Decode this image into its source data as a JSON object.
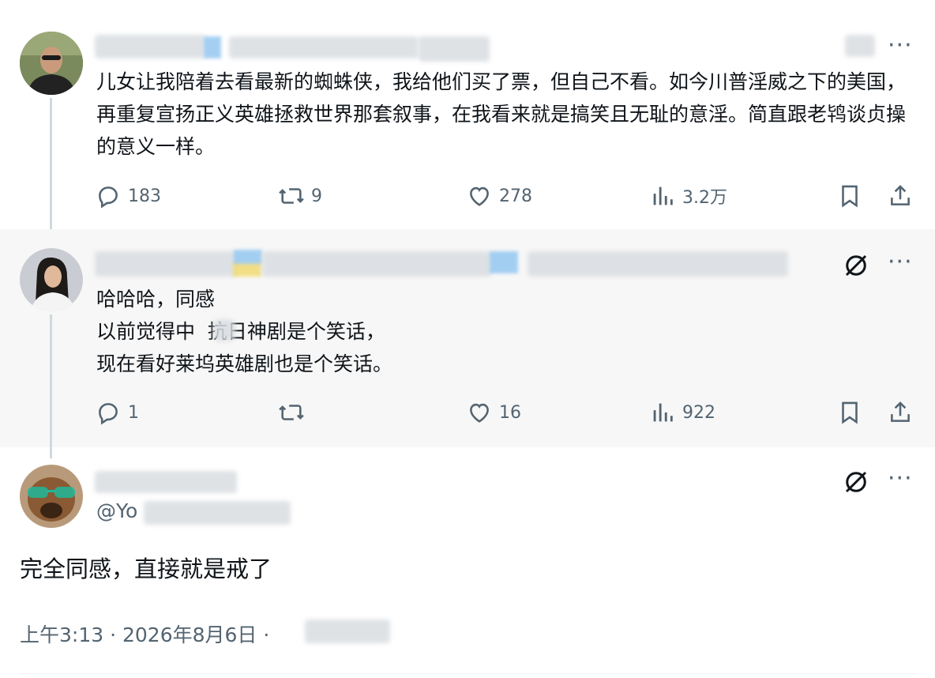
{
  "tweets": [
    {
      "text": "儿女让我陪着去看最新的蜘蛛侠，我给他们买了票，但自己不看。如今川普淫威之下的美国，再重复宣扬正义英雄拯救世界那套叙事，在我看来就是搞笑且无耻的意淫。简直跟老鸨谈贞操的意义一样。",
      "replies": "183",
      "reposts": "9",
      "likes": "278",
      "views": "3.2万"
    },
    {
      "lines": [
        "哈哈哈，同感",
        "以前觉得中  抗日神剧是个笑话，",
        "现在看好莱坞英雄剧也是个笑话。"
      ],
      "replies": "1",
      "reposts": "",
      "likes": "16",
      "views": "922"
    }
  ],
  "main_tweet": {
    "handle_prefix": "@Yo",
    "text": "完全同感，直接就是戒了",
    "timestamp": "上午3:13 · 2026年8月6日 ·"
  },
  "icons": [
    "reply-icon",
    "repost-icon",
    "like-icon",
    "views-icon",
    "bookmark-icon",
    "share-icon",
    "grok-icon",
    "more-icon"
  ],
  "colors": {
    "text": "#0f1419",
    "secondary": "#536471",
    "highlight_bg": "#f7f7f7",
    "line": "#cfd9de"
  }
}
